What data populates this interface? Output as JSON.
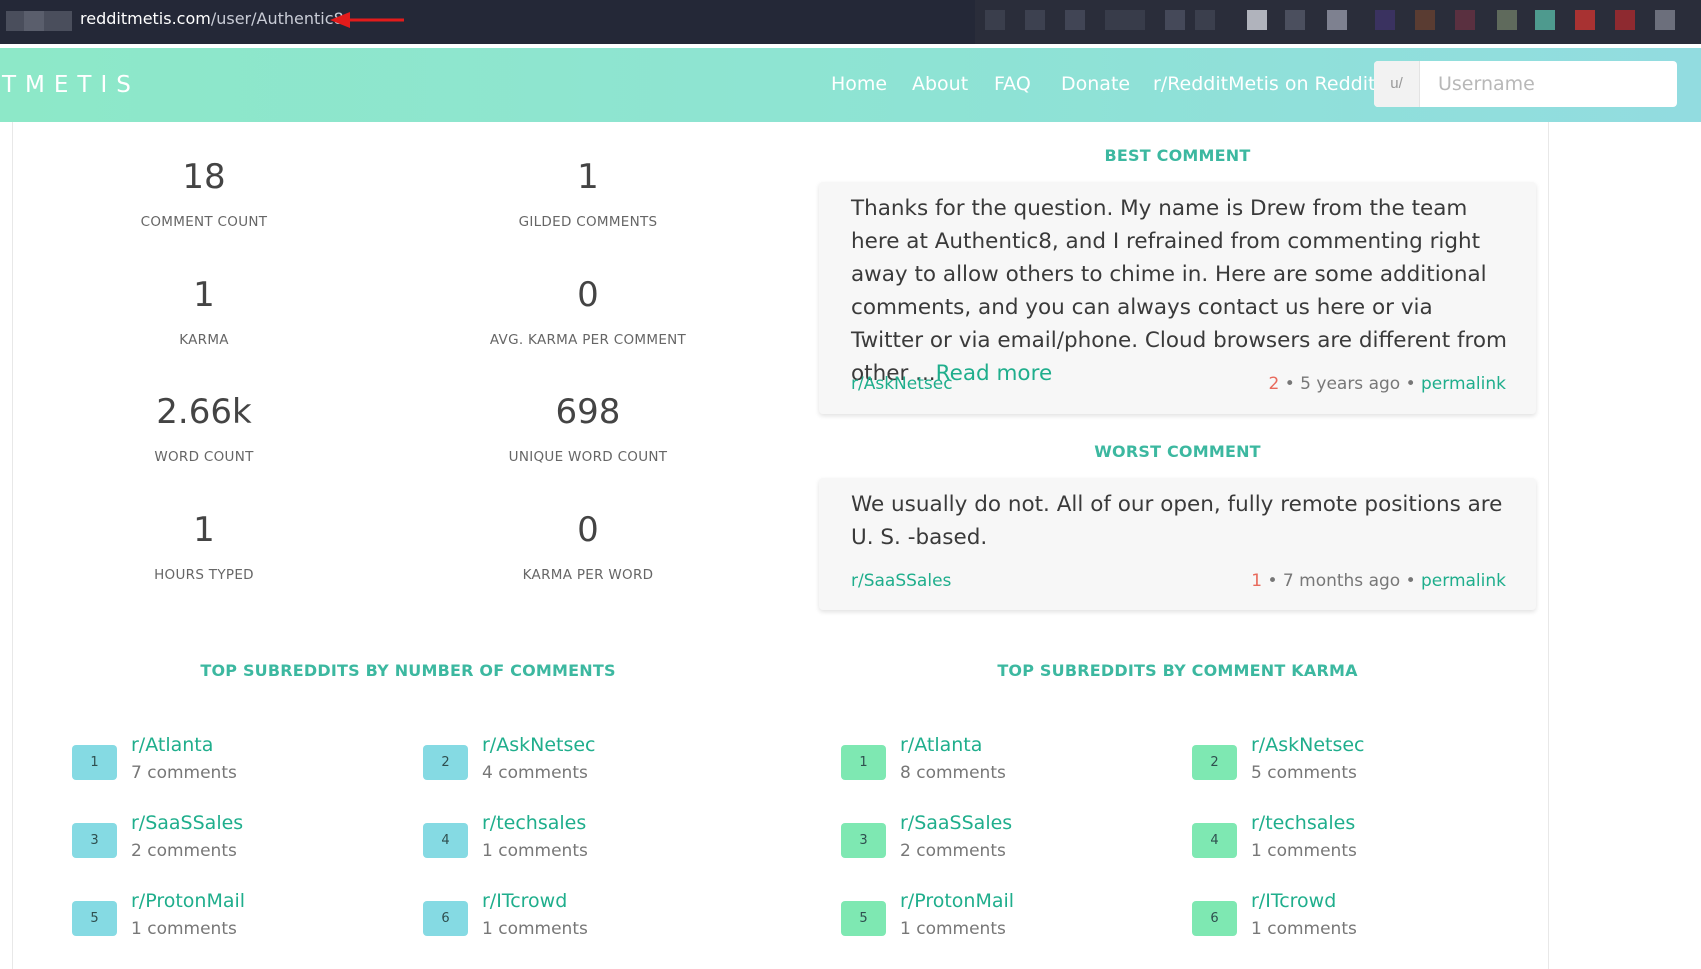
{
  "browser": {
    "url_host": "redditmetis.com",
    "url_path": "/user/Authentic8"
  },
  "navbar": {
    "brand": "TMETIS",
    "links": [
      "Home",
      "About",
      "FAQ",
      "Donate",
      "r/RedditMetis on Reddit"
    ],
    "search_prefix": "u/",
    "search_placeholder": "Username"
  },
  "stats": [
    {
      "value": "18",
      "label": "COMMENT COUNT"
    },
    {
      "value": "1",
      "label": "GILDED COMMENTS"
    },
    {
      "value": "1",
      "label": "KARMA"
    },
    {
      "value": "0",
      "label": "AVG. KARMA PER COMMENT"
    },
    {
      "value": "2.66k",
      "label": "WORD COUNT"
    },
    {
      "value": "698",
      "label": "UNIQUE WORD COUNT"
    },
    {
      "value": "1",
      "label": "HOURS TYPED"
    },
    {
      "value": "0",
      "label": "KARMA PER WORD"
    }
  ],
  "best_comment": {
    "title": "BEST COMMENT",
    "text": "Thanks for the question. My name is Drew from the team here at Authentic8, and I refrained from commenting right away to allow others to chime in. Here are some additional comments, and you can always contact us here or via Twitter or via email/phone. Cloud browsers are different from other ...",
    "read_more": "Read more",
    "subreddit": "r/AskNetsec",
    "score": "2",
    "age": " • 5 years ago • ",
    "permalink": "permalink"
  },
  "worst_comment": {
    "title": "WORST COMMENT",
    "text": "We usually do not. All of our open, fully remote positions are U. S. -based.",
    "subreddit": "r/SaaSSales",
    "score": "1",
    "age": " • 7 months ago • ",
    "permalink": "permalink"
  },
  "top_by_comments": {
    "title": "TOP SUBREDDITS BY NUMBER OF COMMENTS",
    "items": [
      {
        "rank": "1",
        "name": "r/Atlanta",
        "count": "7 comments"
      },
      {
        "rank": "2",
        "name": "r/AskNetsec",
        "count": "4 comments"
      },
      {
        "rank": "3",
        "name": "r/SaaSSales",
        "count": "2 comments"
      },
      {
        "rank": "4",
        "name": "r/techsales",
        "count": "1 comments"
      },
      {
        "rank": "5",
        "name": "r/ProtonMail",
        "count": "1 comments"
      },
      {
        "rank": "6",
        "name": "r/ITcrowd",
        "count": "1 comments"
      }
    ]
  },
  "top_by_karma": {
    "title": "TOP SUBREDDITS BY COMMENT KARMA",
    "items": [
      {
        "rank": "1",
        "name": "r/Atlanta",
        "count": "8 comments"
      },
      {
        "rank": "2",
        "name": "r/AskNetsec",
        "count": "5 comments"
      },
      {
        "rank": "3",
        "name": "r/SaaSSales",
        "count": "2 comments"
      },
      {
        "rank": "4",
        "name": "r/techsales",
        "count": "1 comments"
      },
      {
        "rank": "5",
        "name": "r/ProtonMail",
        "count": "1 comments"
      },
      {
        "rank": "6",
        "name": "r/ITcrowd",
        "count": "1 comments"
      }
    ]
  },
  "colors": {
    "accent": "#1fae8c",
    "title_accent": "#3cb8a0",
    "badge_blue": "#85dae3",
    "badge_green": "#7ee8b2",
    "score_red": "#e86a5c"
  }
}
